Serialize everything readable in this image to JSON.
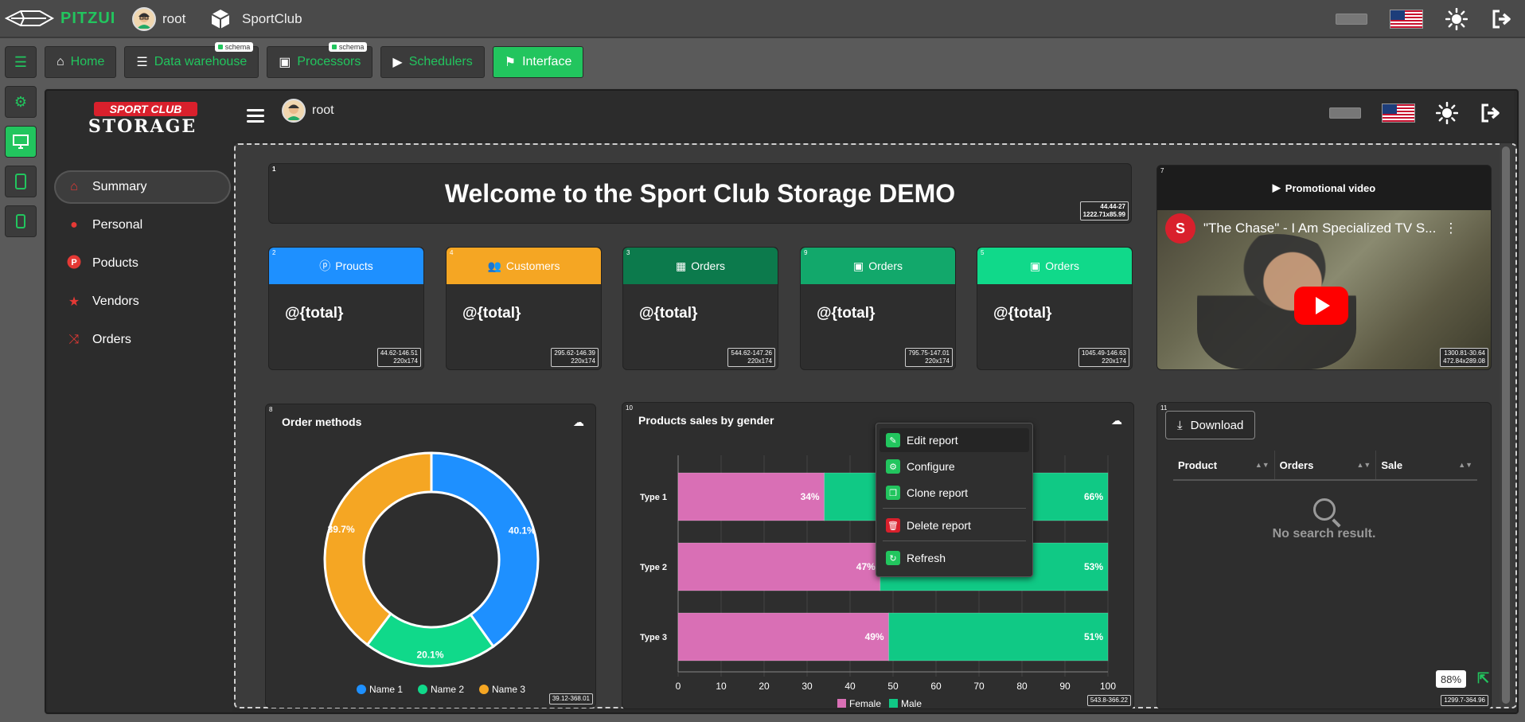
{
  "topbar": {
    "logo_text": "PITZUI",
    "user": "root",
    "app": "SportClub"
  },
  "menubar": {
    "items": [
      {
        "label": "Home"
      },
      {
        "label": "Data warehouse",
        "badge": "schema"
      },
      {
        "label": "Processors",
        "badge": "schema"
      },
      {
        "label": "Schedulers"
      },
      {
        "label": "Interface"
      }
    ]
  },
  "brand": {
    "top": "SPORT CLUB",
    "bottom": "STORAGE"
  },
  "inner_header": {
    "user": "root"
  },
  "nav": {
    "items": [
      {
        "label": "Summary"
      },
      {
        "label": "Personal"
      },
      {
        "label": "Poducts"
      },
      {
        "label": "Vendors"
      },
      {
        "label": "Orders"
      }
    ]
  },
  "widgets": {
    "welcome": {
      "num": "1",
      "text": "Welcome to the Sport Club Storage DEMO",
      "dim1": "44.44-27",
      "dim2": "1222.71x85.99"
    },
    "stats": [
      {
        "num": "2",
        "title": "Proucts",
        "value": "@{total}",
        "dim1": "44.62-146.51",
        "dim2": "220x174",
        "color": "#1e90ff"
      },
      {
        "num": "4",
        "title": "Customers",
        "value": "@{total}",
        "dim1": "295.62-146.39",
        "dim2": "220x174",
        "color": "#f5a623"
      },
      {
        "num": "3",
        "title": "Orders",
        "value": "@{total}",
        "dim1": "544.62-147.26",
        "dim2": "220x174",
        "color": "#0c7a4c"
      },
      {
        "num": "9",
        "title": "Orders",
        "value": "@{total}",
        "dim1": "795.75-147.01",
        "dim2": "220x174",
        "color": "#12a86b"
      },
      {
        "num": "5",
        "title": "Orders",
        "value": "@{total}",
        "dim1": "1045.49-146.63",
        "dim2": "220x174",
        "color": "#10d98a"
      }
    ],
    "video": {
      "num": "7",
      "title": "Promotional video",
      "yt_title": "\"The Chase\" - I Am Specialized TV S...",
      "dim1": "1300.81-30.64",
      "dim2": "472.84x289.08"
    },
    "donut": {
      "num": "8",
      "title": "Order methods",
      "dim1": "39.12-368.01"
    },
    "bar": {
      "num": "10",
      "title": "Products sales by gender",
      "dim1": "543.8-366.22"
    },
    "table": {
      "num": "11",
      "download": "Download",
      "cols": [
        "Product",
        "Orders",
        "Sale"
      ],
      "empty": "No search result.",
      "dim1": "1299.7-364.96"
    }
  },
  "context_menu": {
    "items": [
      "Edit report",
      "Configure",
      "Clone report",
      "Delete report",
      "Refresh"
    ]
  },
  "zoom": "88%",
  "chart_data": [
    {
      "type": "pie",
      "title": "Order methods",
      "categories": [
        "Name 1",
        "Name 2",
        "Name 3"
      ],
      "values": [
        40.1,
        20.1,
        39.7
      ],
      "colors": [
        "#1e90ff",
        "#10d98a",
        "#f5a623"
      ],
      "legend": "bottom"
    },
    {
      "type": "bar",
      "orientation": "horizontal",
      "stacked": true,
      "title": "Products sales by gender",
      "categories": [
        "Type 1",
        "Type 2",
        "Type 3"
      ],
      "series": [
        {
          "name": "Female",
          "values": [
            34,
            47,
            49
          ],
          "color": "#d96fb5"
        },
        {
          "name": "Male",
          "values": [
            66,
            53,
            51
          ],
          "color": "#10c985"
        }
      ],
      "xlim": [
        0,
        100
      ],
      "xticks": [
        0,
        10,
        20,
        30,
        40,
        50,
        60,
        70,
        80,
        90,
        100
      ],
      "legend": "bottom"
    }
  ]
}
